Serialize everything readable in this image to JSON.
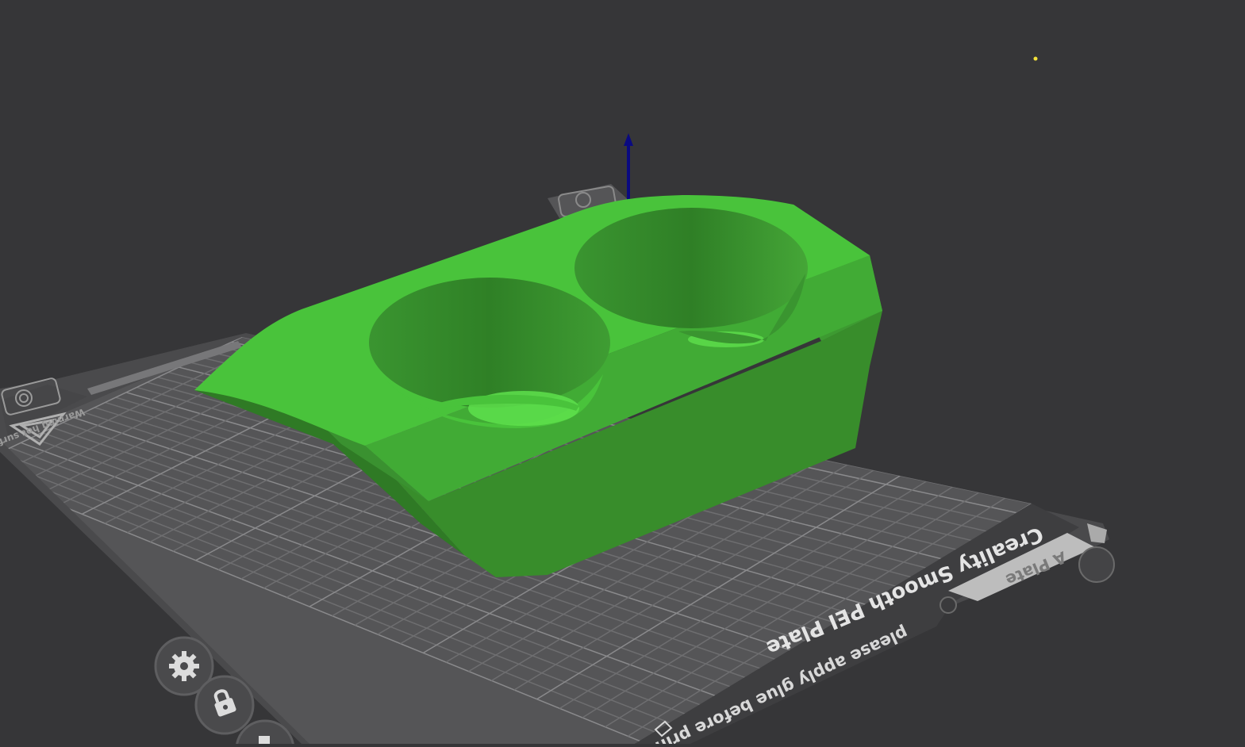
{
  "viewport": {
    "background": "#363638",
    "plate": {
      "name": "Creality Smooth PEI Plate",
      "note": "please apply glue before print",
      "plate_label": "A Plate",
      "warning": "Warning hot surface"
    },
    "model": {
      "color_top": "#49c33b",
      "color_side": "#388d2b",
      "color_dark": "#2f7a25",
      "holes": 2
    },
    "axis": {
      "z_color": "#0a0a80"
    },
    "buttons": [
      {
        "icon": "gear-icon"
      },
      {
        "icon": "lock-icon"
      },
      {
        "icon": "edit-icon"
      }
    ]
  }
}
